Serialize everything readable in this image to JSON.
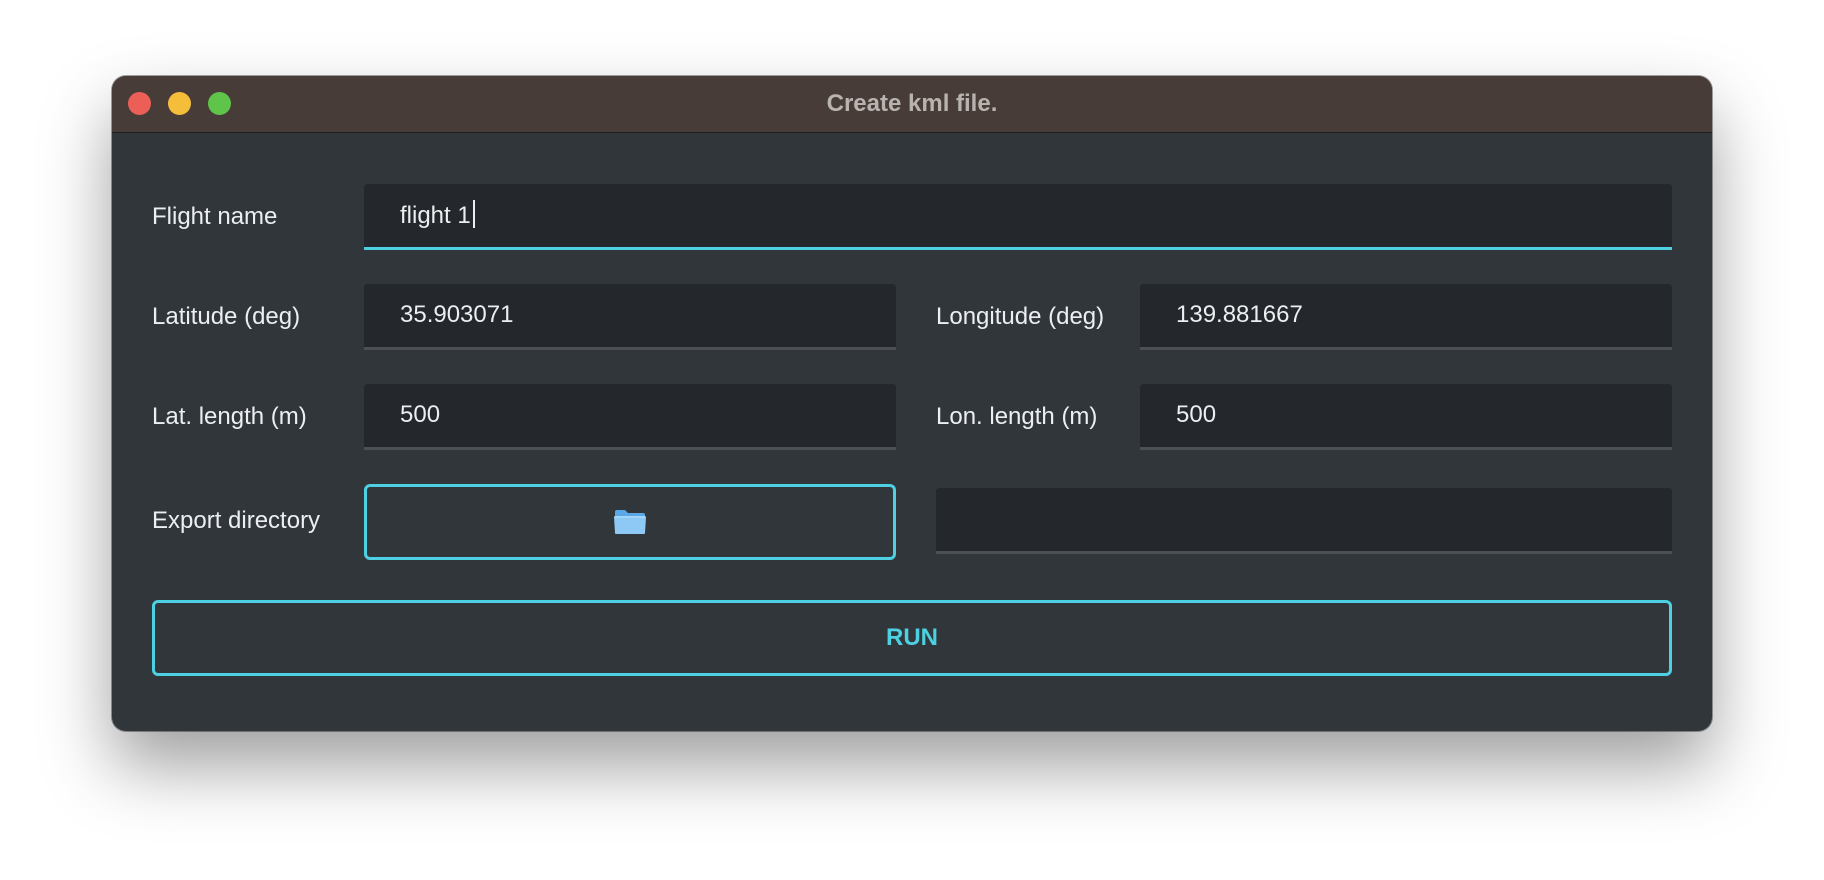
{
  "window": {
    "title": "Create kml file."
  },
  "form": {
    "flight_name": {
      "label": "Flight name",
      "value": "flight 1"
    },
    "latitude": {
      "label": "Latitude (deg)",
      "value": "35.903071"
    },
    "longitude": {
      "label": "Longitude (deg)",
      "value": "139.881667"
    },
    "lat_length": {
      "label": "Lat. length (m)",
      "value": "500"
    },
    "lon_length": {
      "label": "Lon. length (m)",
      "value": "500"
    },
    "export_directory": {
      "label": "Export directory",
      "icon": "folder-icon",
      "path_value": ""
    },
    "run_label": "RUN"
  },
  "colors": {
    "accent": "#4dd0e1",
    "window_bg": "#31363b",
    "field_bg": "#24272b",
    "titlebar_bg": "#473c38"
  }
}
